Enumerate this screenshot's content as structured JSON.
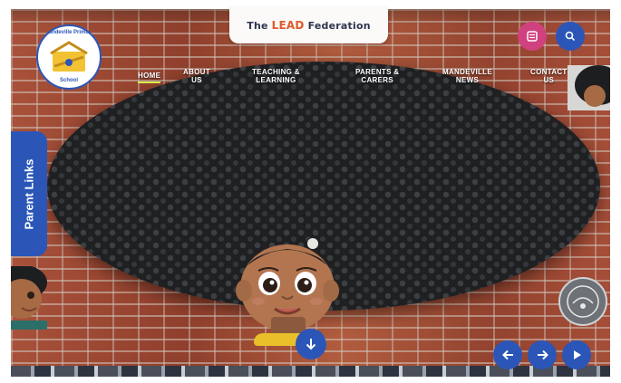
{
  "federation": {
    "prefix": "The",
    "lead": "LEAD",
    "suffix": "Federation"
  },
  "logo": {
    "ring_top": "Mandeville Primary",
    "ring_bottom": "School"
  },
  "nav": {
    "items": [
      {
        "line1": "HOME",
        "line2": ""
      },
      {
        "line1": "ABOUT",
        "line2": "US"
      },
      {
        "line1": "TEACHING &",
        "line2": "LEARNING"
      },
      {
        "line1": "PARENTS &",
        "line2": "CARERS"
      },
      {
        "line1": "MANDEVILLE",
        "line2": "NEWS"
      },
      {
        "line1": "CONTACT",
        "line2": "US"
      }
    ],
    "active": "HOME"
  },
  "parent_links": {
    "label": "Parent Links"
  },
  "icons": {
    "menu": "menu-icon",
    "search": "search-icon",
    "scroll_down": "arrow-down-icon",
    "prev": "arrow-left-icon",
    "next": "arrow-right-icon",
    "play": "play-icon"
  },
  "colors": {
    "brand_blue": "#2b56b8",
    "menu_pink": "#d0417f",
    "nav_underline": "#d8ea4c",
    "lead_orange": "#e05a2b"
  }
}
